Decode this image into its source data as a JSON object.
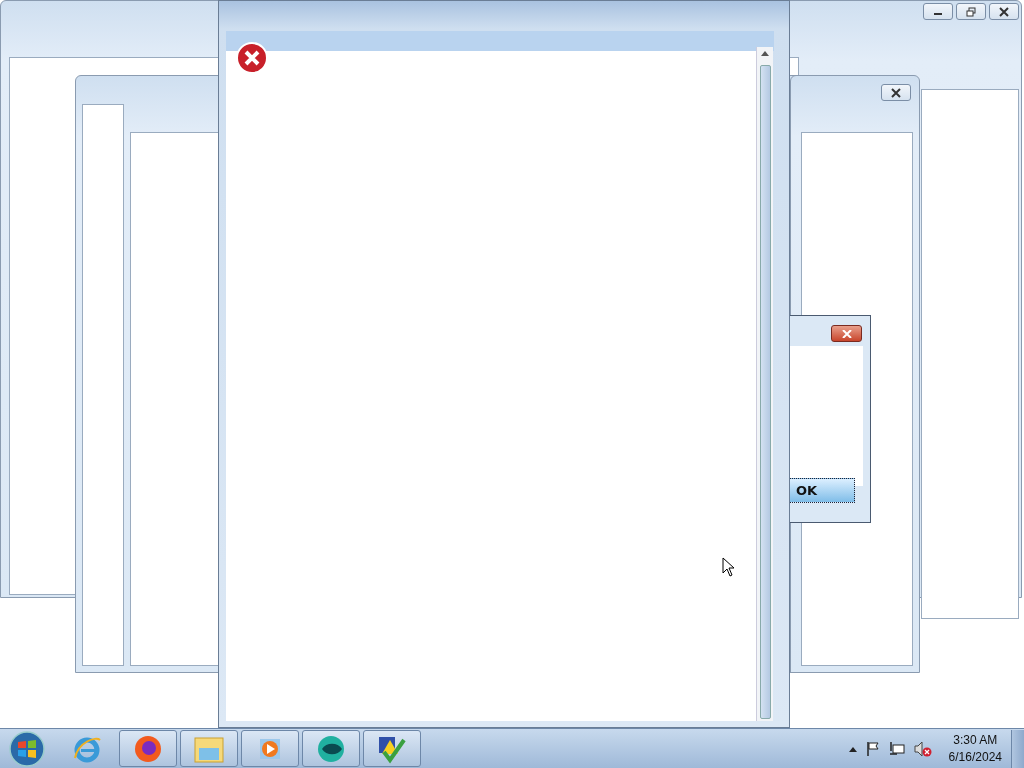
{
  "dialog": {
    "button": "OK"
  },
  "taskbar": {
    "items": [
      {
        "kind": "browser-e",
        "running": false
      },
      {
        "kind": "browser-fox",
        "running": true
      },
      {
        "kind": "folder",
        "running": true
      },
      {
        "kind": "media",
        "running": true
      },
      {
        "kind": "sphere",
        "running": true
      },
      {
        "kind": "check",
        "running": true
      }
    ],
    "time": "3:30 AM",
    "date": "6/16/2024"
  }
}
